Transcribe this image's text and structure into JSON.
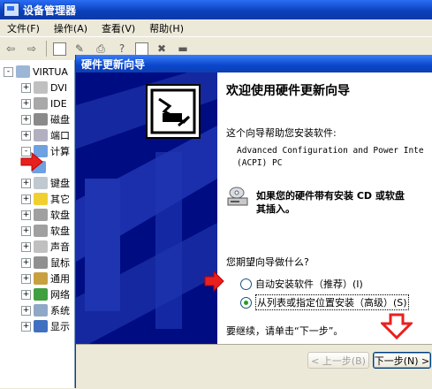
{
  "device_manager": {
    "title": "设备管理器",
    "menu": [
      "文件(F)",
      "操作(A)",
      "查看(V)",
      "帮助(H)"
    ],
    "tree": {
      "root_label": "VIRTUA",
      "items": [
        {
          "label": "DVI",
          "expander": "+"
        },
        {
          "label": "IDE",
          "expander": "+"
        },
        {
          "label": "磁盘",
          "expander": "+"
        },
        {
          "label": "端口",
          "expander": "+"
        },
        {
          "label": "计算",
          "expander": "-"
        },
        {
          "label": "",
          "expander": ""
        },
        {
          "label": "键盘",
          "expander": "+"
        },
        {
          "label": "其它",
          "expander": "+"
        },
        {
          "label": "软盘",
          "expander": "+"
        },
        {
          "label": "软盘",
          "expander": "+"
        },
        {
          "label": "声音",
          "expander": "+"
        },
        {
          "label": "鼠标",
          "expander": "+"
        },
        {
          "label": "通用",
          "expander": "+"
        },
        {
          "label": "网络",
          "expander": "+"
        },
        {
          "label": "系统",
          "expander": "+"
        },
        {
          "label": "显示",
          "expander": "+"
        }
      ]
    }
  },
  "wizard": {
    "title": "硬件更新向导",
    "heading": "欢迎使用硬件更新向导",
    "intro": "这个向导帮助您安装软件:",
    "device_name": "Advanced Configuration and Power Inte\n(ACPI) PC",
    "cd_hint": "如果您的硬件带有安装 CD 或软盘\n其插入。",
    "question": "您期望向导做什么?",
    "options": [
      {
        "label": "自动安装软件（推荐）(I)",
        "selected": false
      },
      {
        "label": "从列表或指定位置安装（高级）(S)",
        "selected": true
      }
    ],
    "continue_text": "要继续，请单击“下一步”。",
    "buttons": {
      "back": "< 上一步(B)",
      "next": "下一步(N) >"
    }
  },
  "colors": {
    "titlebar": "#0a46cc",
    "wizard_left": "#000c82",
    "annotation_arrow": "#e8211e"
  }
}
